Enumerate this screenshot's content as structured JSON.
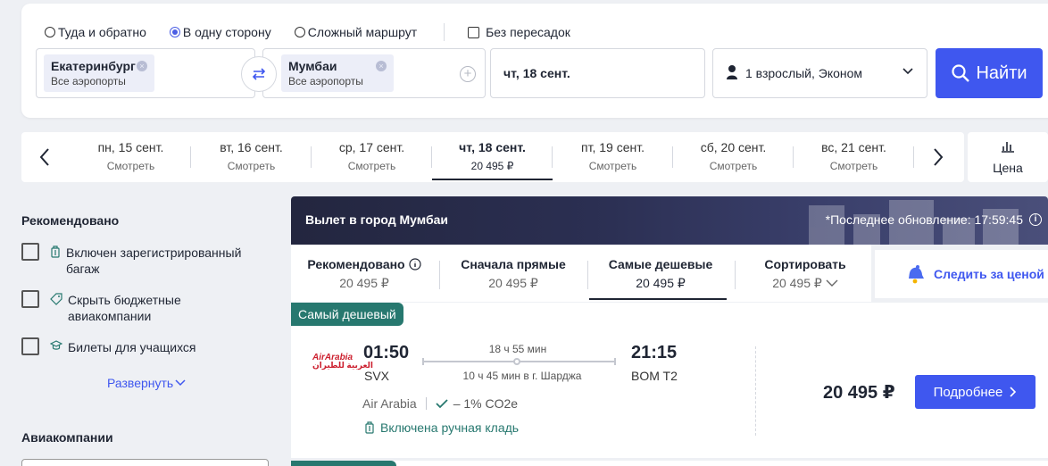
{
  "search": {
    "trip_types": [
      "Туда и обратно",
      "В одну сторону",
      "Сложный маршрут"
    ],
    "selected_trip_type": "В одну сторону",
    "direct_only_label": "Без пересадок",
    "origin": {
      "city": "Екатеринбург",
      "airports": "Все аэропорты"
    },
    "destination": {
      "city": "Мумбаи",
      "airports": "Все аэропорты"
    },
    "date": "чт, 18 сент.",
    "passengers": "1 взрослый, Эконом",
    "search_button": "Найти"
  },
  "date_strip": {
    "items": [
      {
        "date": "пн, 15 сент.",
        "price": "Смотреть"
      },
      {
        "date": "вт, 16 сент.",
        "price": "Смотреть"
      },
      {
        "date": "ср, 17 сент.",
        "price": "Смотреть"
      },
      {
        "date": "чт, 18 сент.",
        "price": "20 495 ₽",
        "active": true
      },
      {
        "date": "пт, 19 сент.",
        "price": "Смотреть"
      },
      {
        "date": "сб, 20 сент.",
        "price": "Смотреть"
      },
      {
        "date": "вс, 21 сент.",
        "price": "Смотреть"
      }
    ],
    "price_chart_label": "Цена"
  },
  "sidebar": {
    "recommended_title": "Рекомендовано",
    "filters": [
      "Включен зарегистрированный багаж",
      "Скрыть бюджетные авиакомпании",
      "Билеты для учащихся"
    ],
    "expand_label": "Развернуть",
    "airlines_title": "Авиакомпании"
  },
  "results": {
    "banner_title": "Вылет в город Мумбаи",
    "last_update": "*Последнее обновление: 17:59:45",
    "sort": [
      {
        "label": "Рекомендовано",
        "price": "20 495 ₽"
      },
      {
        "label": "Сначала прямые",
        "price": "20 495 ₽"
      },
      {
        "label": "Самые дешевые",
        "price": "20 495 ₽",
        "active": true
      },
      {
        "label": "Сортировать",
        "price": "20 495 ₽"
      }
    ],
    "watch_price": "Следить за ценой",
    "cheapest_tag": "Самый дешевый",
    "flight": {
      "logo_text": "AirArabia",
      "logo_arabic": "العربية للطيران",
      "depart_time": "01:50",
      "depart_code": "SVX",
      "duration": "18 ч 55 мин",
      "layover": "10 ч 45 мин в г. Шарджа",
      "arrive_time": "21:15",
      "arrive_code": "BOM T2",
      "airline": "Air Arabia",
      "co2": "– 1% CO2e",
      "baggage": "Включена ручная кладь",
      "price": "20 495 ₽",
      "details_button": "Подробнее"
    }
  },
  "colors": {
    "accent": "#3f57ef",
    "teal": "#27786f",
    "banner": "#2b2f52"
  }
}
